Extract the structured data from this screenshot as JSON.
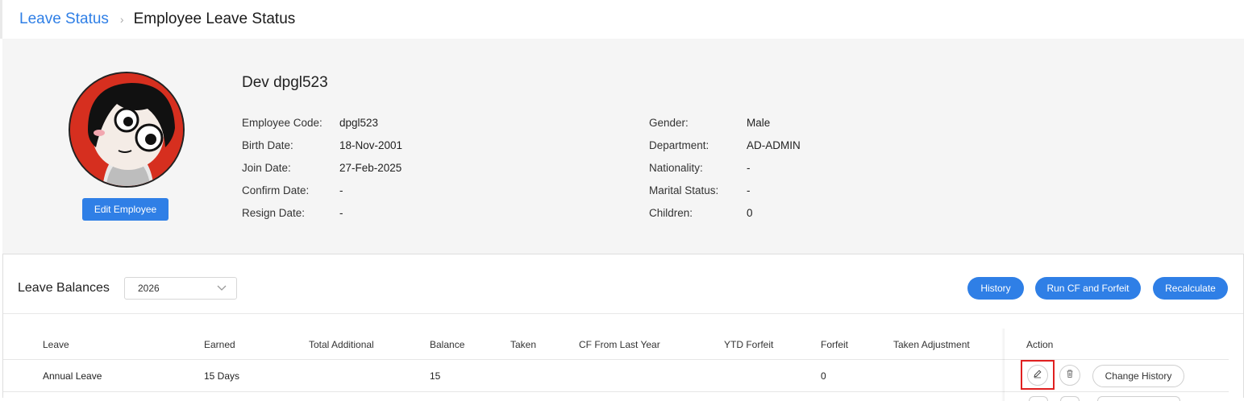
{
  "breadcrumb": {
    "parent": "Leave Status",
    "separator": "›",
    "current": "Employee Leave Status"
  },
  "employee": {
    "name": "Dev dpgl523",
    "edit_button": "Edit Employee",
    "left_fields": [
      {
        "label": "Employee Code:",
        "value": "dpgl523"
      },
      {
        "label": "Birth Date:",
        "value": "18-Nov-2001"
      },
      {
        "label": "Join Date:",
        "value": "27-Feb-2025"
      },
      {
        "label": "Confirm Date:",
        "value": "-"
      },
      {
        "label": "Resign Date:",
        "value": "-"
      }
    ],
    "right_fields": [
      {
        "label": "Gender:",
        "value": "Male"
      },
      {
        "label": "Department:",
        "value": "AD-ADMIN"
      },
      {
        "label": "Nationality:",
        "value": "-"
      },
      {
        "label": "Marital Status:",
        "value": "-"
      },
      {
        "label": "Children:",
        "value": "0"
      }
    ]
  },
  "balances": {
    "title": "Leave Balances",
    "year": "2026",
    "buttons": {
      "history": "History",
      "run_cf": "Run CF and Forfeit",
      "recalculate": "Recalculate"
    },
    "columns": [
      "Leave",
      "Earned",
      "Total Additional",
      "Balance",
      "Taken",
      "CF From Last Year",
      "YTD Forfeit",
      "Forfeit",
      "Taken Adjustment",
      "Action"
    ],
    "rows": [
      {
        "leave": "Annual Leave",
        "earned": "15 Days",
        "total_additional": "",
        "balance": "15",
        "taken": "",
        "cf_from_last_year": "",
        "ytd_forfeit": "",
        "forfeit": "0",
        "taken_adjustment": "",
        "change_history": "Change History"
      }
    ]
  },
  "colors": {
    "accent": "#2f7fe6",
    "highlight": "#e02020",
    "avatar_bg": "#d62f1f"
  },
  "icons": {
    "edit": "pencil-icon",
    "delete": "trash-icon",
    "select": "chevron-down-icon"
  }
}
